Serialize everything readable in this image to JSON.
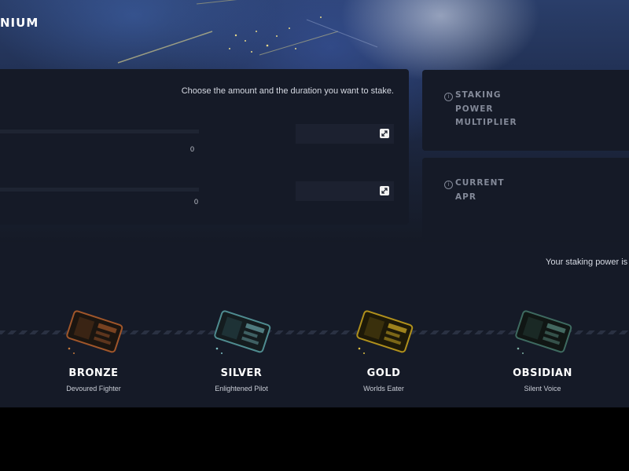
{
  "header": {
    "brand_fragment": "NIUM"
  },
  "stake": {
    "instruction": "Choose the amount and the duration you want to stake.",
    "amount_value": "0",
    "duration_value": "0"
  },
  "stats": [
    {
      "label_lines": [
        "STAKING",
        "POWER",
        "MULTIPLIER"
      ]
    },
    {
      "label_lines": [
        "CURRENT",
        "APR"
      ]
    }
  ],
  "tiers": {
    "power_text": "Your staking power is",
    "items": [
      {
        "name": "BRONZE",
        "subtitle": "Devoured Fighter",
        "color": "#a0562a"
      },
      {
        "name": "SILVER",
        "subtitle": "Enlightened Pilot",
        "color": "#4f8c90"
      },
      {
        "name": "GOLD",
        "subtitle": "Worlds Eater",
        "color": "#b0901c"
      },
      {
        "name": "OBSIDIAN",
        "subtitle": "Silent Voice",
        "color": "#3e6a60"
      }
    ]
  }
}
